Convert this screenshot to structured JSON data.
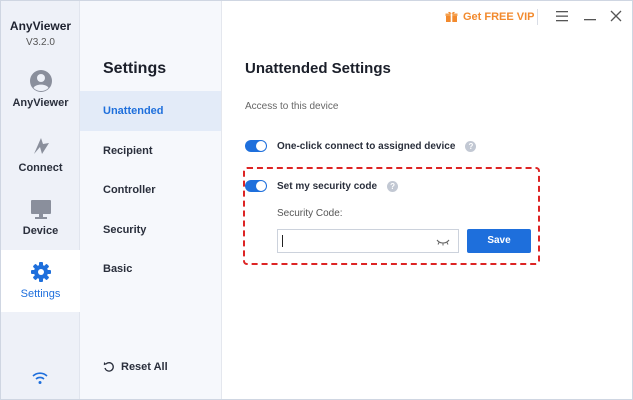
{
  "app": {
    "name": "AnyViewer",
    "version": "V3.2.0"
  },
  "nav": {
    "items": [
      {
        "label": "AnyViewer",
        "icon": "user-avatar-icon"
      },
      {
        "label": "Connect",
        "icon": "connect-icon"
      },
      {
        "label": "Device",
        "icon": "monitor-icon"
      },
      {
        "label": "Settings",
        "icon": "gear-icon",
        "active": true
      }
    ],
    "bottom_icon": "wifi-icon"
  },
  "topbar": {
    "vip_label": "Get FREE VIP",
    "vip_icon": "gift-icon"
  },
  "settings_menu": {
    "title": "Settings",
    "items": [
      {
        "label": "Unattended",
        "active": true
      },
      {
        "label": "Recipient"
      },
      {
        "label": "Controller"
      },
      {
        "label": "Security"
      },
      {
        "label": "Basic"
      }
    ],
    "reset_label": "Reset All"
  },
  "unattended": {
    "title": "Unattended Settings",
    "section_label": "Access to this device",
    "option_one_click": {
      "label": "One-click connect to assigned device",
      "enabled": true
    },
    "option_security_code": {
      "label": "Set my security code",
      "enabled": true
    },
    "security_code_label": "Security Code:",
    "security_code_value": "",
    "save_label": "Save"
  },
  "colors": {
    "accent": "#1e6fdc",
    "vip": "#f28a2e",
    "highlight": "#dd2424"
  }
}
